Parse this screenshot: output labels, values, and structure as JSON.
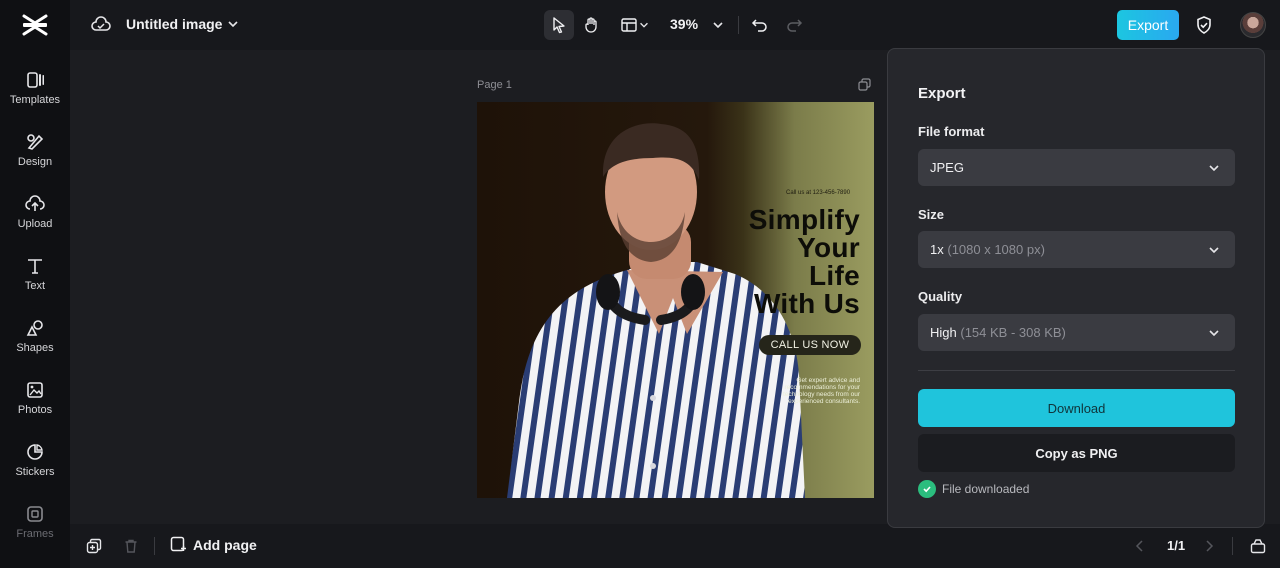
{
  "sidebar": {
    "items": [
      {
        "label": "Templates",
        "icon": "templates-icon"
      },
      {
        "label": "Design",
        "icon": "design-icon"
      },
      {
        "label": "Upload",
        "icon": "upload-icon"
      },
      {
        "label": "Text",
        "icon": "text-icon"
      },
      {
        "label": "Shapes",
        "icon": "shapes-icon"
      },
      {
        "label": "Photos",
        "icon": "photos-icon"
      },
      {
        "label": "Stickers",
        "icon": "stickers-icon"
      },
      {
        "label": "Frames",
        "icon": "frames-icon"
      }
    ]
  },
  "topbar": {
    "title": "Untitled image",
    "zoom": "39%",
    "export_label": "Export"
  },
  "canvas": {
    "page_label": "Page 1",
    "design": {
      "phone_line": "Call us at 123-456-7890",
      "headline": [
        "Simplify",
        "Your",
        "Life",
        "With Us"
      ],
      "cta": "CALL US NOW",
      "blurb": "Get expert advice and recommendations for your technology needs from our experienced consultants."
    }
  },
  "bottombar": {
    "add_page_label": "Add page",
    "pager": "1/1"
  },
  "export_panel": {
    "title": "Export",
    "file_format_label": "File format",
    "file_format_value": "JPEG",
    "size_label": "Size",
    "size_value": "1x",
    "size_hint": "(1080 x 1080 px)",
    "quality_label": "Quality",
    "quality_value": "High",
    "quality_hint": "(154 KB - 308 KB)",
    "download_label": "Download",
    "copy_label": "Copy as PNG",
    "status_text": "File downloaded"
  },
  "colors": {
    "accent": "#1fc4dc",
    "success": "#2bbd7e",
    "panel_bg": "#26272c"
  }
}
